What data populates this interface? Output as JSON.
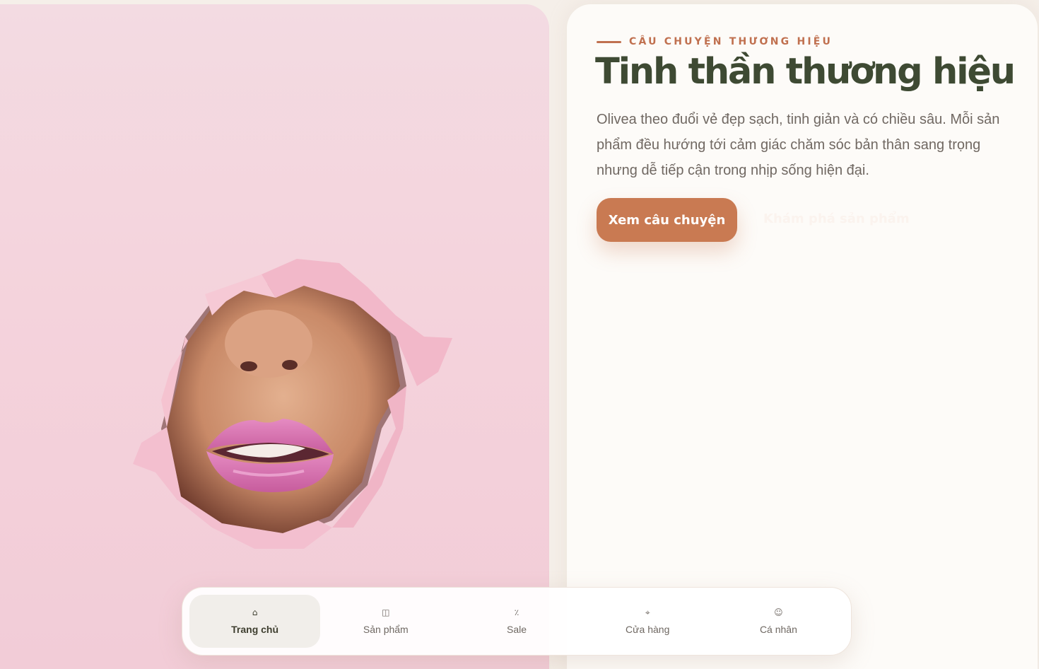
{
  "hero": {
    "image_alt": "Khuôn mặt với đôi môi hồng nhìn qua lỗ rách trên giấy hồng"
  },
  "story": {
    "eyebrow": "Câu chuyện thương hiệu",
    "title": "Tinh thần thương hiệu",
    "description": "Olivea theo đuổi vẻ đẹp sạch, tinh giản và có chiều sâu. Mỗi sản phẩm đều hướng tới cảm giác chăm sóc bản thân sang trọng nhưng dễ tiếp cận trong nhịp sống hiện đại.",
    "primary_cta": "Xem câu chuyện",
    "secondary_cta": "Khám phá sản phẩm"
  },
  "nav": {
    "items": [
      {
        "label": "Trang chủ",
        "icon": "home-icon",
        "glyph": "⌂",
        "active": true
      },
      {
        "label": "Sản phẩm",
        "icon": "book-icon",
        "glyph": "◫",
        "active": false
      },
      {
        "label": "Sale",
        "icon": "percent-icon",
        "glyph": "٪",
        "active": false
      },
      {
        "label": "Cửa hàng",
        "icon": "location-pin-icon",
        "glyph": "⌖",
        "active": false
      },
      {
        "label": "Cá nhân",
        "icon": "user-icon",
        "glyph": "☺",
        "active": false
      }
    ]
  },
  "colors": {
    "accent": "#c97a52",
    "eyebrow": "#c0704f",
    "title": "#3e4a33",
    "hero_pink": "#f4d3dc",
    "lips": "#d86fae"
  }
}
